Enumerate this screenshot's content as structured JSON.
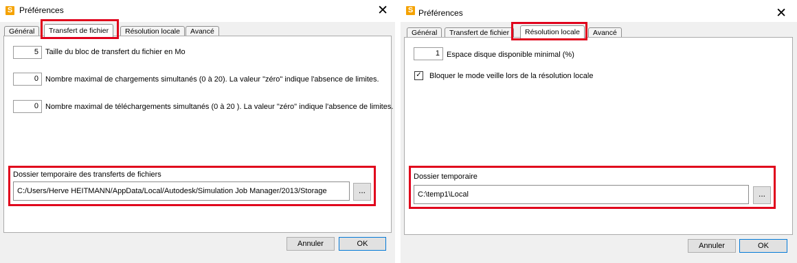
{
  "left": {
    "title": "Préférences",
    "app_icon": "S",
    "tabs": [
      "Général",
      "Transfert de fichier",
      "Résolution locale",
      "Avancé"
    ],
    "active_tab": "Transfert de fichier",
    "fields": [
      {
        "value": "5",
        "label": "Taille du bloc de transfert du fichier en Mo"
      },
      {
        "value": "0",
        "label": "Nombre maximal de chargements simultanés (0 à 20). La valeur \"zéro\" indique l'absence de limites."
      },
      {
        "value": "0",
        "label": "Nombre maximal de téléchargements simultanés (0 à 20 ). La valeur \"zéro\" indique l'absence de limites."
      }
    ],
    "folder_label": "Dossier temporaire des transferts de fichiers",
    "folder_path": "C:/Users/Herve HEITMANN/AppData/Local/Autodesk/Simulation Job Manager/2013/Storage",
    "browse_label": "...",
    "cancel_label": "Annuler",
    "ok_label": "OK"
  },
  "right": {
    "title": "Préférences",
    "app_icon": "S",
    "tabs": [
      "Général",
      "Transfert de fichier",
      "Résolution locale",
      "Avancé"
    ],
    "active_tab": "Résolution locale",
    "field": {
      "value": "1",
      "label": "Espace disque disponible minimal (%)"
    },
    "checkbox": {
      "checked": true,
      "label": "Bloquer le mode veille lors de la résolution locale"
    },
    "folder_label": "Dossier temporaire",
    "folder_path": "C:\\temp1\\Local",
    "browse_label": "...",
    "cancel_label": "Annuler",
    "ok_label": "OK"
  },
  "colors": {
    "highlight": "#e0001b",
    "accent": "#0078d7",
    "app_icon": "#f5a200"
  },
  "icons": {
    "close": "close-icon",
    "checkbox": "checkmark-icon"
  }
}
